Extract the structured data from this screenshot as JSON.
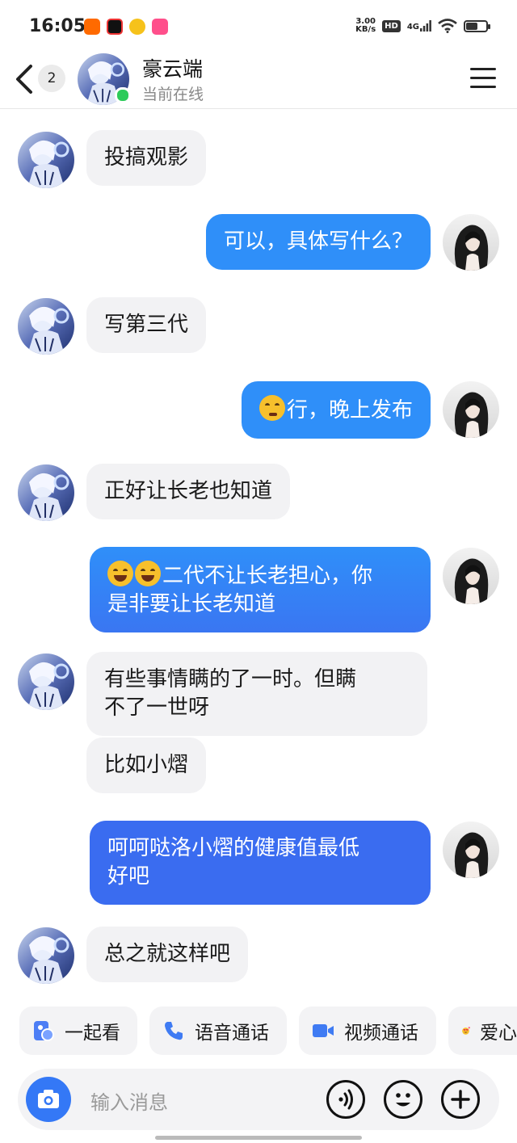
{
  "status_bar": {
    "time": "16:05",
    "net_speed_value": "3.00",
    "net_speed_unit": "KB/s",
    "hd": "HD",
    "network": "4G",
    "battery_percent": 60,
    "app_icons": [
      "app-orange-icon",
      "app-red-video-icon",
      "weibo-icon",
      "app-pink-icon"
    ]
  },
  "header": {
    "unread_count": "2",
    "contact_name": "豪云端",
    "contact_status": "当前在线"
  },
  "messages": [
    {
      "side": "left",
      "text": "投搞观影"
    },
    {
      "side": "right",
      "text": "可以，具体写什么？"
    },
    {
      "side": "left",
      "text": "写第三代"
    },
    {
      "side": "right",
      "emoji": "thinking-face",
      "text": "行，晚上发布"
    },
    {
      "side": "left",
      "text": "正好让长老也知道"
    },
    {
      "side": "right",
      "emoji": "laughing-face",
      "line1": "二代不让长老担心，你",
      "line2": "是非要让长老知道"
    },
    {
      "side": "left",
      "line1": "有些事情瞒的了一时。但瞒",
      "line2": "不了一世呀"
    },
    {
      "side": "left",
      "text": "比如小熠"
    },
    {
      "side": "right",
      "line1": "呵呵哒洛小熠的健康值最低",
      "line2": "好吧"
    },
    {
      "side": "left",
      "text": "总之就这样吧"
    }
  ],
  "quick_actions": [
    {
      "label": "一起看",
      "icon": "watch-together-icon"
    },
    {
      "label": "语音通话",
      "icon": "phone-icon"
    },
    {
      "label": "视频通话",
      "icon": "video-camera-icon"
    },
    {
      "label": "爱心",
      "icon": "heart-eyes-emoji-icon"
    }
  ],
  "input": {
    "placeholder": "输入消息"
  },
  "colors": {
    "bubble_right_light": "#2f8ff9",
    "bubble_right_dark": "#3a6cf0",
    "bubble_left": "#f2f2f4",
    "accent": "#3478f6",
    "online": "#2dcb5a"
  }
}
